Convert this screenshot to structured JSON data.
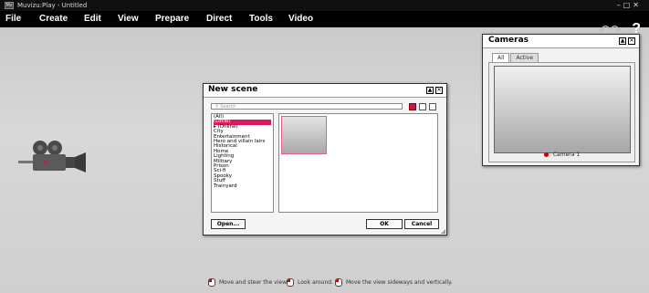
{
  "window": {
    "title": "Muvizu:Play - Untitled",
    "app_icon": "Mz"
  },
  "menubar": {
    "items": [
      "File",
      "Create",
      "Edit",
      "View",
      "Prepare",
      "Direct",
      "Tools",
      "Video"
    ]
  },
  "toolbar": {
    "undo_icon": "undo-icon",
    "redo_icon": "redo-icon",
    "help_label": "?"
  },
  "cameras_panel": {
    "title": "Cameras",
    "tabs": [
      "All",
      "Active"
    ],
    "active_tab": "All",
    "camera_label": "Camera 1",
    "camera_dot_color": "#cc0000"
  },
  "new_scene_dialog": {
    "title": "New scene",
    "search_placeholder": "Search",
    "categories": [
      "(All)",
      "(Local)",
      "(Online)",
      "City",
      "Entertainment",
      "Hero and villain lairs",
      "Historical",
      "Home",
      "Lighting",
      "Military",
      "Prison",
      "Sci-fi",
      "Spooky",
      "Stuff",
      "Trainyard"
    ],
    "selected_category": "(Local)",
    "accent_color": "#d81b60",
    "buttons": {
      "open": "Open...",
      "ok": "OK",
      "cancel": "Cancel"
    }
  },
  "status_hints": [
    "Move and steer the view.",
    "Look around.",
    "Move the view sideways and vertically."
  ]
}
